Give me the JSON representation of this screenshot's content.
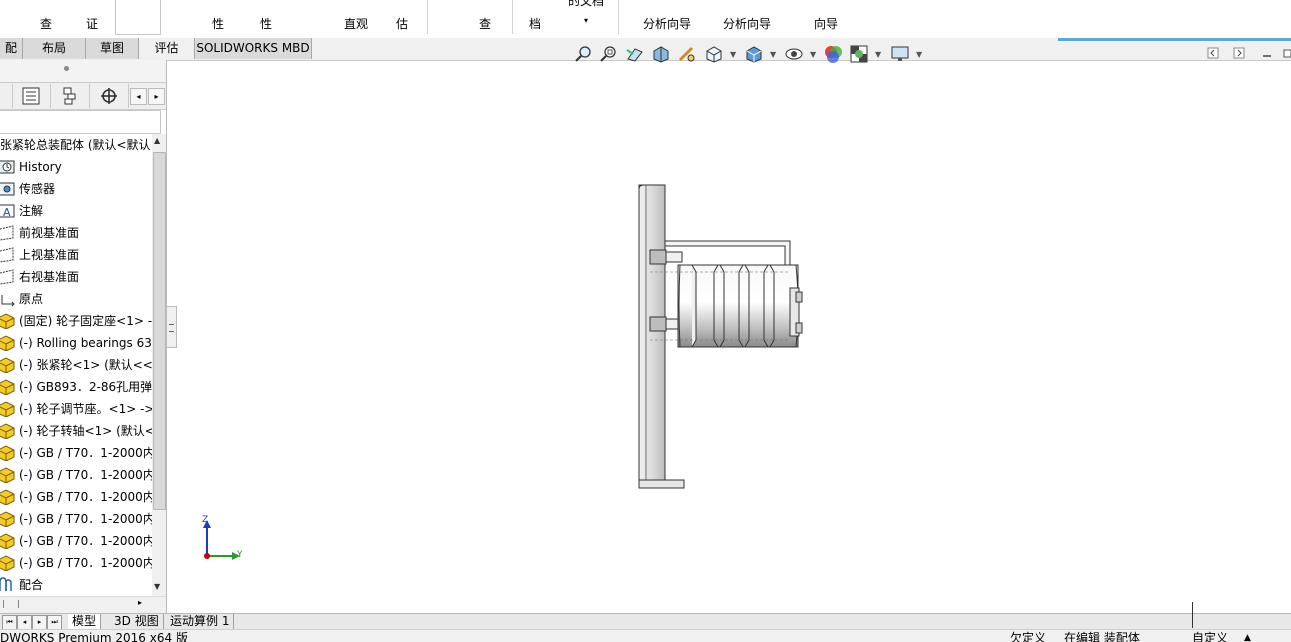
{
  "ribbon": {
    "items": [
      {
        "id": "r1",
        "line1": "",
        "line2": "查"
      },
      {
        "id": "r2",
        "line1": "",
        "line2": "证"
      },
      {
        "id": "r3",
        "line1": "",
        "line2": "性"
      },
      {
        "id": "r4",
        "line1": "",
        "line2": "性"
      },
      {
        "id": "r5",
        "line1": "",
        "line2": "直观"
      },
      {
        "id": "r6",
        "line1": "",
        "line2": "估"
      },
      {
        "id": "r7",
        "line1": "",
        "line2": "查"
      },
      {
        "id": "r8",
        "line1": "",
        "line2": "档"
      },
      {
        "id": "r9",
        "line1": "的文档",
        "line2": "▾"
      },
      {
        "id": "r10",
        "line1": "",
        "line2": "分析向导"
      },
      {
        "id": "r11",
        "line1": "",
        "line2": "分析向导"
      },
      {
        "id": "r12",
        "line1": "",
        "line2": "向导"
      }
    ]
  },
  "command_tabs": [
    "配体",
    "布局",
    "草图",
    "评估",
    "SOLIDWORKS MBD"
  ],
  "tree": {
    "root": "张紧轮总装配体  (默认<默认",
    "items": [
      {
        "label": "History",
        "icon": "history-icon"
      },
      {
        "label": "传感器",
        "icon": "sensor-icon"
      },
      {
        "label": "注解",
        "icon": "annotation-icon"
      },
      {
        "label": "前视基准面",
        "icon": "plane-icon"
      },
      {
        "label": "上视基准面",
        "icon": "plane-icon"
      },
      {
        "label": "右视基准面",
        "icon": "plane-icon"
      },
      {
        "label": "原点",
        "icon": "origin-icon"
      },
      {
        "label": "(固定) 轮子固定座<1> -",
        "icon": "part-icon"
      },
      {
        "label": "(-) Rolling bearings 63",
        "icon": "part-icon"
      },
      {
        "label": "(-) 张紧轮<1> (默认<<默",
        "icon": "part-icon"
      },
      {
        "label": "(-) GB893．2-86孔用弹",
        "icon": "part-icon"
      },
      {
        "label": "(-) 轮子调节座。<1> ->",
        "icon": "part-icon"
      },
      {
        "label": "(-) 轮子转轴<1> (默认<",
        "icon": "part-icon"
      },
      {
        "label": "(-) GB / T70．1-2000内",
        "icon": "part-icon"
      },
      {
        "label": "(-) GB / T70．1-2000内",
        "icon": "part-icon"
      },
      {
        "label": "(-) GB / T70．1-2000内",
        "icon": "part-icon"
      },
      {
        "label": "(-) GB / T70．1-2000内",
        "icon": "part-icon"
      },
      {
        "label": "(-) GB / T70．1-2000内",
        "icon": "part-icon"
      },
      {
        "label": "(-) GB / T70．1-2000内",
        "icon": "part-icon"
      },
      {
        "label": "配合",
        "icon": "mates-icon"
      }
    ]
  },
  "triad": {
    "z": "Z",
    "y": "Y"
  },
  "bottom_tabs": [
    "模型",
    "3D 视图",
    "运动算例 1"
  ],
  "status": {
    "app": "DWORKS Premium 2016 x64 版",
    "defined": "欠定义",
    "editing": "在编辑 装配体",
    "custom": "自定义",
    "arrow": "▲"
  },
  "colors": {
    "accent": "#5aa7d8",
    "part": "#e8c020"
  }
}
